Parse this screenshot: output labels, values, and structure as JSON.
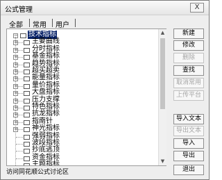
{
  "window": {
    "title": "公式管理",
    "close_label": "X"
  },
  "tabs": [
    {
      "label": "全部",
      "active": true
    },
    {
      "label": "常用",
      "active": false
    },
    {
      "label": "用户",
      "active": false
    }
  ],
  "tree": {
    "root": "技术指标",
    "items": [
      {
        "label": "主要曲线",
        "expandable": true
      },
      {
        "label": "分时指标",
        "expandable": true
      },
      {
        "label": "基金指标",
        "expandable": true
      },
      {
        "label": "趋势指标",
        "expandable": true
      },
      {
        "label": "超买超卖",
        "expandable": true
      },
      {
        "label": "能量指标",
        "expandable": true
      },
      {
        "label": "量价指标",
        "expandable": true
      },
      {
        "label": "大盘指标",
        "expandable": true
      },
      {
        "label": "压力支撑",
        "expandable": true
      },
      {
        "label": "特色指标",
        "expandable": true
      },
      {
        "label": "抗龙指标",
        "expandable": true
      },
      {
        "label": "指南针",
        "expandable": true
      },
      {
        "label": "神光指标",
        "expandable": true
      },
      {
        "label": "强弱指标",
        "expandable": false
      },
      {
        "label": "波段指标",
        "expandable": false
      },
      {
        "label": "抄底逃顶",
        "expandable": false
      },
      {
        "label": "资金指标",
        "expandable": false
      },
      {
        "label": "主题指标",
        "expandable": false
      }
    ]
  },
  "buttons": [
    {
      "label": "新建",
      "enabled": true
    },
    {
      "label": "修改",
      "enabled": true
    },
    {
      "label": "删除",
      "enabled": false
    },
    {
      "label": "查找",
      "enabled": true
    },
    {
      "label": "取消常用",
      "enabled": false
    },
    {
      "label": "上传平台",
      "enabled": false
    },
    {
      "label": "导入文本",
      "enabled": true
    },
    {
      "label": "导出文本",
      "enabled": false
    },
    {
      "label": "导入",
      "enabled": true
    },
    {
      "label": "导出",
      "enabled": true
    },
    {
      "label": "退出",
      "enabled": true
    }
  ],
  "footer": {
    "link_text": "访问同花顺公式讨论区"
  },
  "colors": {
    "selection": "#0a246a",
    "disabled_text": "#a6a6a6"
  }
}
